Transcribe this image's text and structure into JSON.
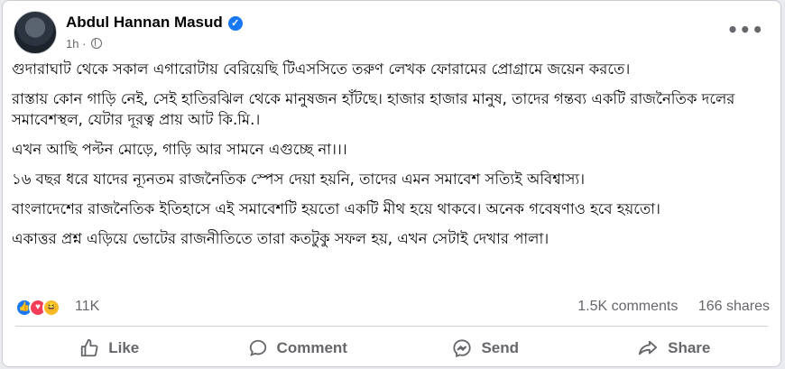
{
  "post": {
    "author": "Abdul Hannan Masud",
    "time": "1h",
    "time_separator": "·",
    "more_icon": "•••",
    "paragraphs": [
      "গুদারাঘাট থেকে সকাল এগারোটায় বেরিয়েছি টিএসসিতে তরুণ লেখক ফোরামের প্রোগ্রামে জয়েন করতে।",
      "রাস্তায় কোন গাড়ি নেই, সেই হাতিরঝিল থেকে মানুষজন হাঁটছে। হাজার হাজার মানুষ, তাদের গন্তব্য একটি রাজনৈতিক দলের সমাবেশস্থল, যেটার দূরত্ব প্রায় আট কি.মি.।",
      "এখন আছি পল্টন মোড়ে, গাড়ি আর সামনে এগুচ্ছে না।।।",
      "১৬ বছর ধরে যাদের ন্যূনতম রাজনৈতিক স্পেস দেয়া হয়নি, তাদের এমন সমাবেশ সত্যিই অবিশ্বাস্য।",
      "বাংলাদেশের রাজনৈতিক ইতিহাসে এই সমাবেশটি হয়তো একটি মীথ হয়ে থাকবে। অনেক গবেষণাও হবে হয়তো।",
      "একাত্তর প্রশ্ন এড়িয়ে ভোটের রাজনীতিতে তারা কতটুকু সফল হয়, এখন সেটাই দেখার পালা।"
    ]
  },
  "stats": {
    "reactions_count": "11K",
    "comments": "1.5K comments",
    "shares": "166 shares",
    "reaction_icons": [
      "like-icon",
      "love-icon",
      "haha-icon"
    ],
    "colors": {
      "like": "#1877f2",
      "love": "#f33e58",
      "haha": "#f7b928"
    }
  },
  "actions": {
    "like": "Like",
    "comment": "Comment",
    "send": "Send",
    "share": "Share"
  }
}
